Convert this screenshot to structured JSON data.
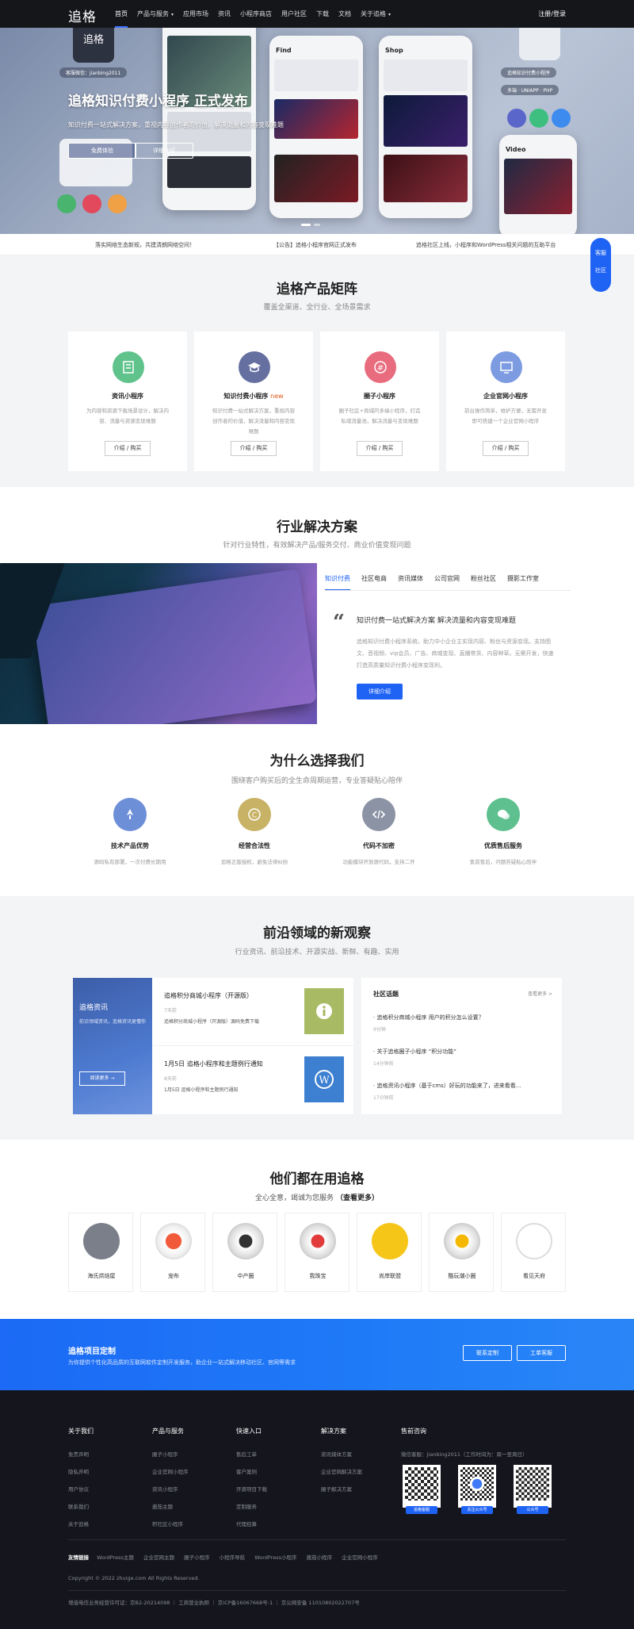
{
  "nav": {
    "logo": "追格",
    "items": [
      "首页",
      "产品与服务",
      "应用市场",
      "资讯",
      "小程序商店",
      "用户社区",
      "下载",
      "文档",
      "关于追格"
    ],
    "login": "注册/登录"
  },
  "hero": {
    "wechat": "客服微信：jianbing2011",
    "title": "追格知识付费小程序 正式发布",
    "subtitle": "知识付费一站式解决方案，重视内容创作者的价值，解决流量和内容变现难题",
    "btn_primary": "免费体验",
    "btn_secondary": "详细介绍",
    "phone_labels": [
      "Find",
      "Shop",
      "Video"
    ],
    "pill_1": "追格知识付费小程序",
    "pill_2": "多端 · UNIAPP · PHP",
    "logo_card": "追格"
  },
  "ticker": [
    "落实网络生态新规，共建清朗网络空间！",
    "【公告】追格小程序官网正式发布",
    "追格社区上线，小程序和WordPress相关问题的互助平台"
  ],
  "sidebar": {
    "kefu": "客服",
    "community": "社区"
  },
  "products": {
    "title": "追格产品矩阵",
    "subtitle": "覆盖全渠道、全行业、全场景需求",
    "cards": [
      {
        "name": "资讯小程序",
        "badge": "",
        "desc": "为内容和资源下载场景设计，解决内容、流量与资源变现难题",
        "btn": "介绍 / 购买",
        "color": "#5fc38b"
      },
      {
        "name": "知识付费小程序",
        "badge": "new",
        "desc": "知识付费一站式解决方案，重视内容创作者的价值，解决流量和内容变现难题",
        "btn": "介绍 / 购买",
        "color": "#6670a0"
      },
      {
        "name": "圈子小程序",
        "badge": "",
        "desc": "圈子社区+商城的多端小程序，打造私域流量池，解决流量与变现难题",
        "btn": "介绍 / 购买",
        "color": "#e86b7e"
      },
      {
        "name": "企业官网小程序",
        "badge": "",
        "desc": "前台操作简单，维护方便，无需开发即可搭建一个企业官网小程序",
        "btn": "介绍 / 购买",
        "color": "#7c9be0"
      }
    ]
  },
  "solutions": {
    "title": "行业解决方案",
    "subtitle": "针对行业特性，有效解决产品/服务交付、商业价值变现问题",
    "tabs": [
      "知识付费",
      "社区电商",
      "资讯媒体",
      "公司官网",
      "粉丝社区",
      "摄影工作室"
    ],
    "quote_mark": "“",
    "heading": "知识付费一站式解决方案 解决流量和内容变现难题",
    "desc": "追格知识付费小程序系统，助力中小企业主实现内容、粉丝与资源变现。支持图文、音视频、vip会员、广告、商城变现、直播带货、内容种草。无需开发，快速打造高质量知识付费小程序变现利。",
    "btn": "详细介绍"
  },
  "why": {
    "title": "为什么选择我们",
    "subtitle": "围绕客户购买后的全生命周期运营，专业答疑贴心陪伴",
    "items": [
      {
        "title": "技术产品优势",
        "desc": "源码私有部署，一次付费长期用",
        "color": "#6d8fd8"
      },
      {
        "title": "经营合法性",
        "desc": "追格正版授权，避免法律纠纷",
        "color": "#c8b266"
      },
      {
        "title": "代码不加密",
        "desc": "功能模块开放源代码，支持二开",
        "color": "#8b93a5"
      },
      {
        "title": "优质售后服务",
        "desc": "售前售后，问题答疑贴心陪伴",
        "color": "#5ec08f"
      }
    ]
  },
  "news": {
    "title": "前沿领域的新观察",
    "subtitle": "行业资讯、前沿技术、开源实战、新鲜、有趣、实用",
    "banner_title": "追格资讯",
    "banner_sub": "前沿领域资讯，追格资讯更懂你",
    "banner_btn": "阅读更多 →",
    "items": [
      {
        "title": "追格积分商城小程序（开源版）",
        "meta": "7天前",
        "desc": "追格积分商城小程序（开源版）源码免费下载"
      },
      {
        "title": "1月5日 追格小程序和主题例行通知",
        "meta": "8天前",
        "desc": "1月5日 追格小程序和主题例行通知"
      }
    ],
    "forum_title": "社区话题",
    "forum_more": "查看更多 >",
    "forum_items": [
      {
        "title": "· 追格积分商城小程序 用户的积分怎么设置？",
        "time": "9分钟"
      },
      {
        "title": "· 关于追格圈子小程序 “积分功能”",
        "time": "14分钟前"
      },
      {
        "title": "· 追格资讯小程序（基于cms）好玩的功能来了，进来看看…",
        "time": "17分钟前"
      }
    ]
  },
  "clients": {
    "title": "他们都在用追格",
    "subtitle": "全心全意，竭诚为您服务",
    "subtitle_link": "（查看更多）",
    "items": [
      "海氏烘焙屋",
      "宠布",
      "中产圈",
      "我珠宝",
      "尚岸联盟",
      "酷玩潮小圈",
      "看见天府"
    ]
  },
  "banner": {
    "title": "追格项目定制",
    "subtitle": "为你提供个性化高品质的互联网软件定制开发服务，助企业一站式解决移动社区、官网等需求",
    "btn_1": "联系定制",
    "btn_2": "工单客服"
  },
  "footer": {
    "cols": [
      {
        "title": "关于我们",
        "links": [
          "免责声明",
          "隐私声明",
          "用户协议",
          "联系我们",
          "关于追格"
        ]
      },
      {
        "title": "产品与服务",
        "links": [
          "圈子小程序",
          "企业官网小程序",
          "资讯小程序",
          "酱茄主题",
          "积社区小程序"
        ]
      },
      {
        "title": "快速入口",
        "links": [
          "售后工单",
          "客户案例",
          "开源项目下载",
          "定制服务",
          "代理招募"
        ]
      },
      {
        "title": "解决方案",
        "links": [
          "资讯媒体方案",
          "企业官网解决方案",
          "圈子解决方案"
        ]
      }
    ],
    "contact_title": "售前咨询",
    "contact_line": "微信客服：Jianbing2011（工作时间为：周一至周日）",
    "qr_labels": [
      "追格客服",
      "关注公众号",
      "公众号"
    ],
    "links_title": "友情链接",
    "links": [
      "WordPress主题",
      "企业官网主题",
      "圈子小程序",
      "小程序导航",
      "WordPress小程序",
      "酱茄小程序",
      "企业官网小程序"
    ],
    "copyright": "Copyright © 2022 zhuige.com All Rights Reserved.",
    "icp": "增值电信业务经营许可证：京B2-20214098 ｜ 工商营业执照 ｜ 京ICP备16067668号-1 ｜ 京公网安备 11010802022707号"
  }
}
